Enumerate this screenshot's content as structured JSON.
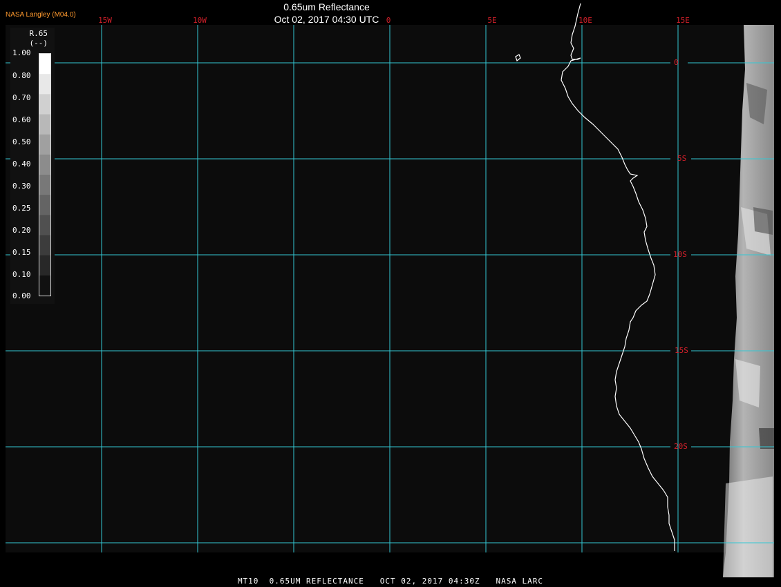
{
  "header": {
    "title": "0.65um Reflectance",
    "datetime": "Oct 02, 2017 04:30 UTC",
    "organization": "NASA Langley (M04.0)"
  },
  "map": {
    "longitude_labels": [
      "15W",
      "10W",
      "0",
      "5E",
      "10E",
      "15E"
    ],
    "latitude_labels": [
      "0",
      "5S",
      "10S",
      "15S",
      "20S"
    ],
    "grid_color": "#33c8d4",
    "label_color": "#d4202a",
    "coastline_color": "#ffffff",
    "background_color": "#0c0c0c"
  },
  "legend": {
    "name": "R.65",
    "unit": "(--)",
    "ticks": [
      "1.00",
      "0.80",
      "0.70",
      "0.60",
      "0.50",
      "0.40",
      "0.30",
      "0.25",
      "0.20",
      "0.15",
      "0.10",
      "0.00"
    ],
    "colors": [
      "#ffffff",
      "#e8e8e8",
      "#d0d0d0",
      "#b8b8b8",
      "#a0a0a0",
      "#8c8c8c",
      "#787878",
      "#646464",
      "#505050",
      "#3c3c3c",
      "#282828",
      "#111111"
    ]
  },
  "footer": {
    "text": "MT10  0.65UM REFLECTANCE   OCT 02, 2017 04:30Z   NASA LARC"
  }
}
